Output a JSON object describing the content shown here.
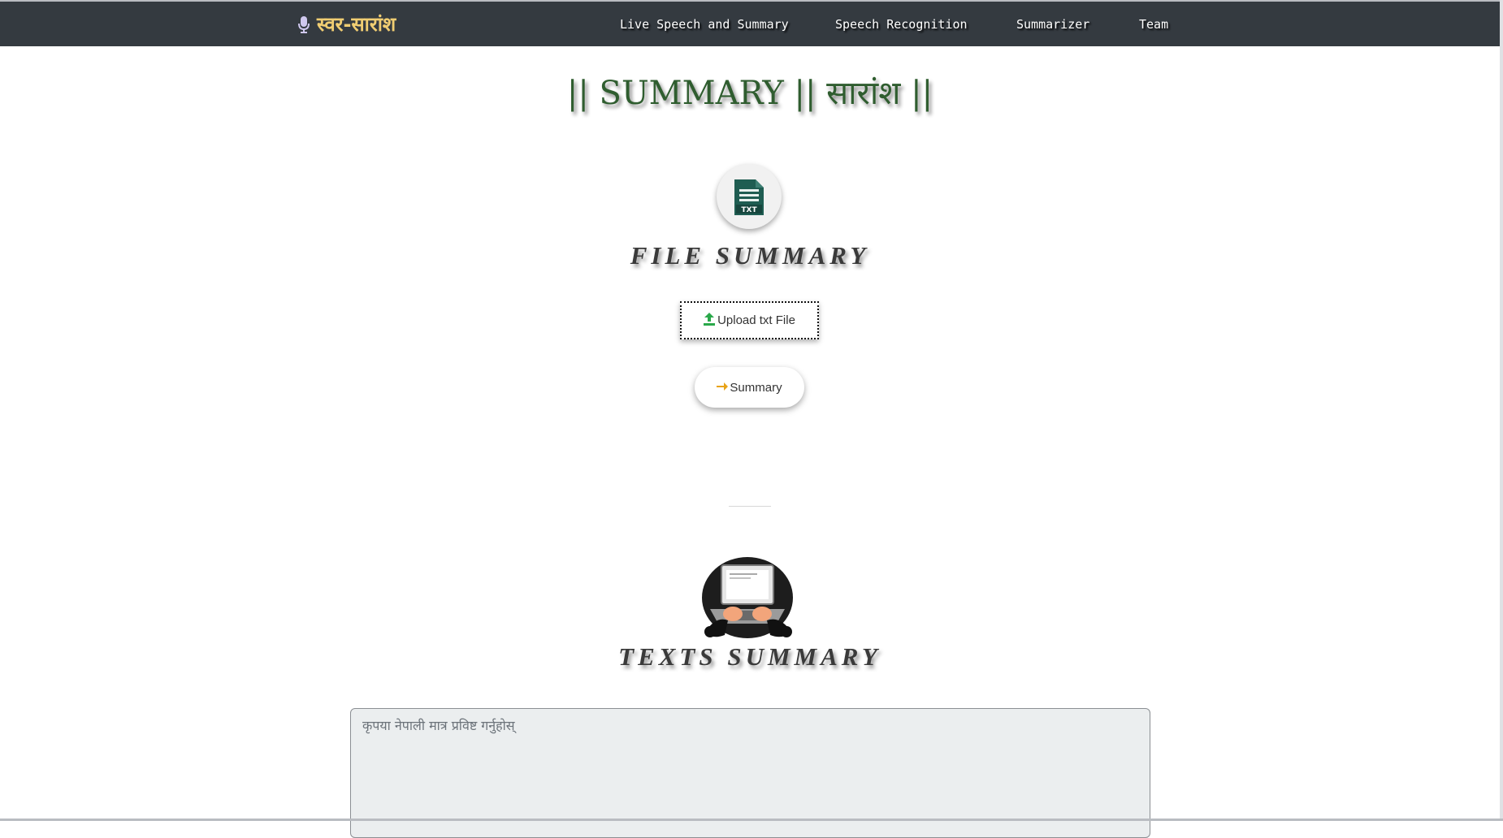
{
  "navbar": {
    "brand_label": "स्वर-सारांश",
    "brand_icon": "microphone-icon",
    "links": [
      {
        "label": "Live Speech and Summary"
      },
      {
        "label": "Speech Recognition"
      },
      {
        "label": "Summarizer"
      },
      {
        "label": "Team"
      }
    ],
    "background_color": "#343a40",
    "brand_color": "#f0cd72"
  },
  "main": {
    "title": "|| SUMMARY || सारांश ||",
    "title_color": "#2f5d2f",
    "file_section": {
      "icon": "txt-file-icon",
      "icon_label": "TXT",
      "heading": "FILE SUMMARY",
      "upload_button_label": "Upload txt File",
      "upload_icon": "upload-icon",
      "summary_button_label": "Summary",
      "summary_icon": "arrow-right-icon"
    },
    "text_section": {
      "illustration": "laptop-typing-illustration",
      "heading": "TEXTS SUMMARY",
      "textarea_placeholder": "कृपया नेपाली मात्र प्रविष्ट गर्नुहोस्",
      "textarea_value": ""
    }
  }
}
